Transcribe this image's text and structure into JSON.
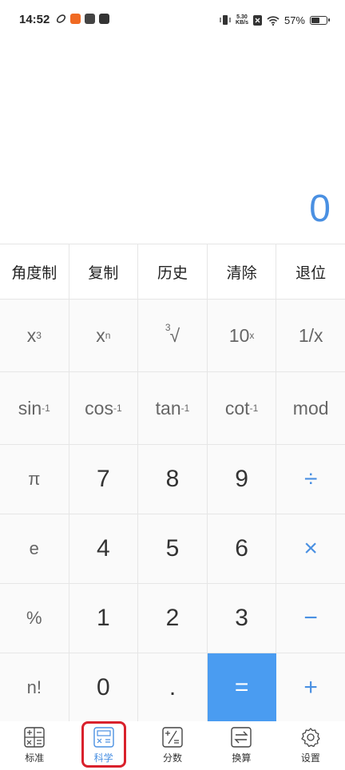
{
  "status_bar": {
    "time": "14:52",
    "network_speed_value": "5.30",
    "network_speed_unit": "KB/s",
    "battery_percent": "57%",
    "battery_level": 0.57,
    "icons": [
      "app-notification-icon",
      "orange-app-icon",
      "vivo-app-icon",
      "message-icon",
      "vibrate-icon",
      "sim-icon",
      "wifi-icon",
      "battery-icon"
    ]
  },
  "display": {
    "result": "0"
  },
  "top_row": [
    "角度制",
    "复制",
    "历史",
    "清除",
    "退位"
  ],
  "fn_row1": {
    "x3": {
      "base": "x",
      "sup": "3"
    },
    "xn": {
      "base": "x",
      "sup": "n"
    },
    "cbrt": {
      "pre": "3",
      "root": "√"
    },
    "ten_x": {
      "base": "10",
      "sup": "x"
    },
    "reciprocal": "1/x"
  },
  "fn_row2": {
    "asin": {
      "base": "sin",
      "sup": "-1"
    },
    "acos": {
      "base": "cos",
      "sup": "-1"
    },
    "atan": {
      "base": "tan",
      "sup": "-1"
    },
    "acot": {
      "base": "cot",
      "sup": "-1"
    },
    "mod": "mod"
  },
  "num_rows": [
    [
      "π",
      "7",
      "8",
      "9",
      "÷"
    ],
    [
      "e",
      "4",
      "5",
      "6",
      "×"
    ],
    [
      "%",
      "1",
      "2",
      "3",
      "−"
    ],
    [
      "n!",
      "0",
      ".",
      "=",
      "+"
    ]
  ],
  "tabs": [
    {
      "label": "标准",
      "icon": "standard-calc-icon"
    },
    {
      "label": "科学",
      "icon": "scientific-calc-icon",
      "active": true
    },
    {
      "label": "分数",
      "icon": "fraction-icon"
    },
    {
      "label": "换算",
      "icon": "conversion-icon"
    },
    {
      "label": "设置",
      "icon": "gear-icon"
    }
  ],
  "colors": {
    "accent": "#4a90e2",
    "equals_bg": "#4a9cf1",
    "highlight": "#d9212c"
  }
}
